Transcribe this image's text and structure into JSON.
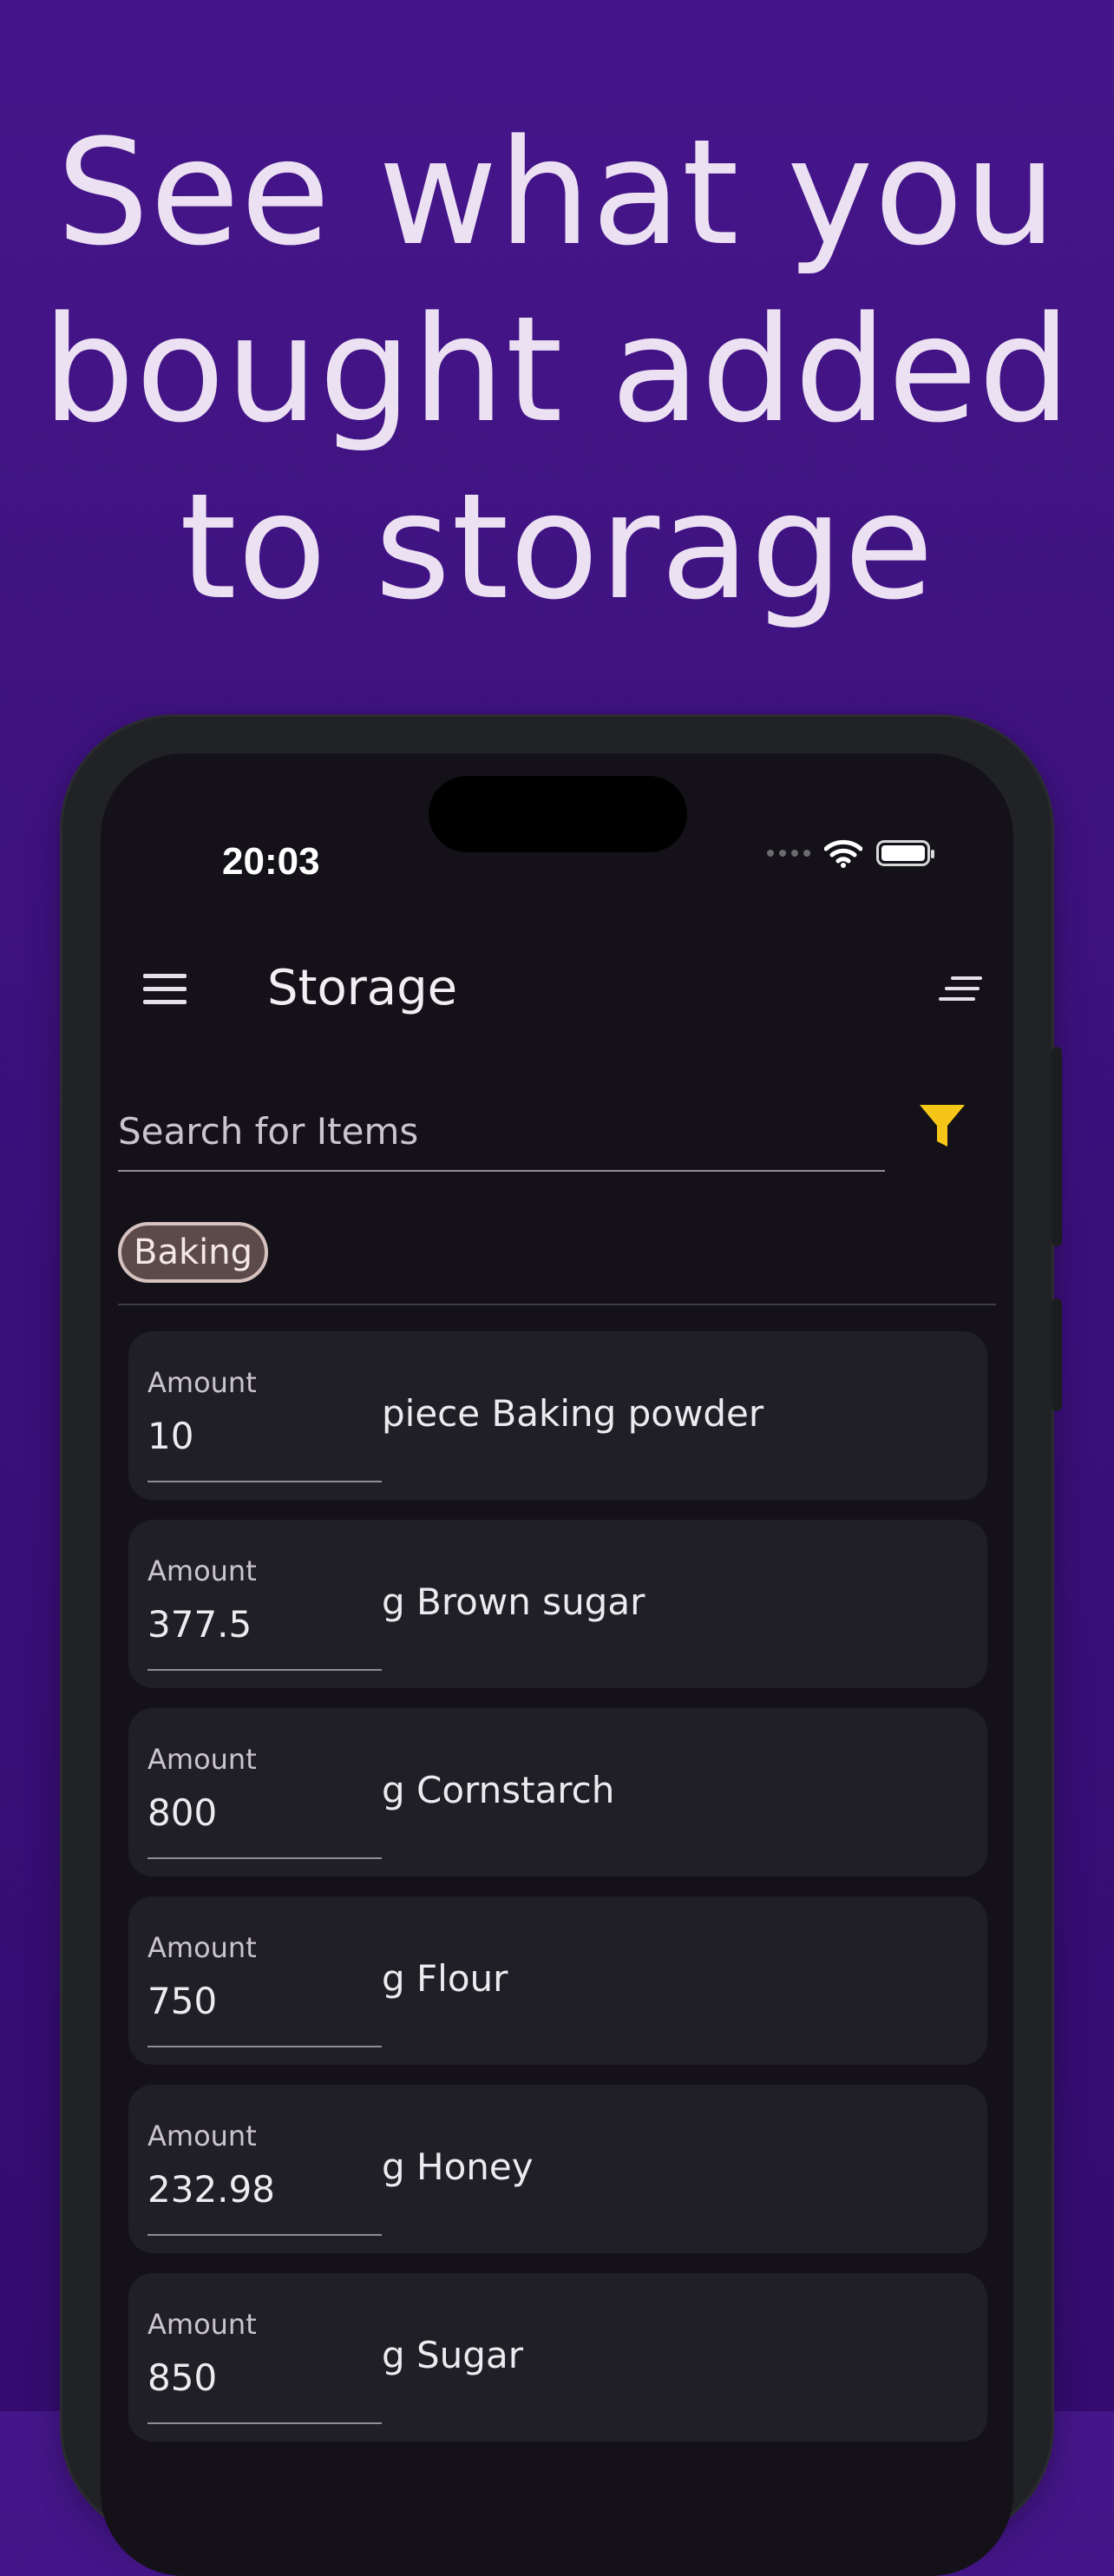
{
  "headline": {
    "line1": "See what you",
    "line2": "bought added",
    "line3": "to storage"
  },
  "status_bar": {
    "time": "20:03"
  },
  "app_bar": {
    "title": "Storage",
    "menu_icon": "hamburger-menu-icon",
    "sort_icon": "sort-icon"
  },
  "search": {
    "placeholder": "Search for Items",
    "filter_icon": "filter-icon",
    "filter_color": "#f5c518"
  },
  "chips": [
    {
      "label": "Baking"
    }
  ],
  "items": [
    {
      "amount_label": "Amount",
      "amount": "10",
      "name": "piece Baking powder"
    },
    {
      "amount_label": "Amount",
      "amount": "377.5",
      "name": "g Brown sugar"
    },
    {
      "amount_label": "Amount",
      "amount": "800",
      "name": "g Cornstarch"
    },
    {
      "amount_label": "Amount",
      "amount": "750",
      "name": "g Flour"
    },
    {
      "amount_label": "Amount",
      "amount": "232.98",
      "name": "g Honey"
    },
    {
      "amount_label": "Amount",
      "amount": "850",
      "name": "g Sugar"
    }
  ],
  "colors": {
    "background_top": "#45168a",
    "background_bottom": "#340c70",
    "headline_text": "#ece0f3",
    "screen_bg": "#141218",
    "card_bg": "#211f26",
    "chip_bg": "#5b4a48"
  }
}
